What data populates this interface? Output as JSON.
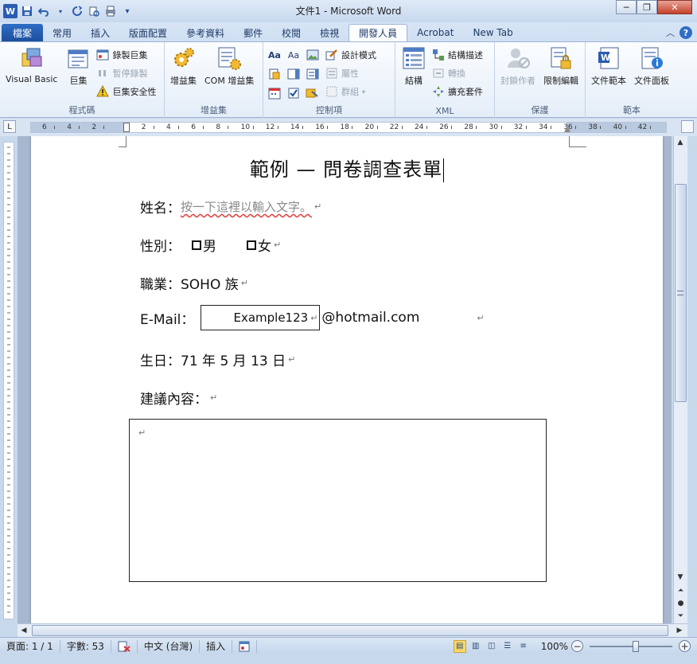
{
  "window": {
    "title": "文件1 - Microsoft Word",
    "minimize": "─",
    "restore": "❐",
    "close": "✕"
  },
  "qat": {
    "logo": "W",
    "save_icon": "floppy-disk-icon",
    "undo_icon": "undo-icon",
    "redo_icon": "redo-icon",
    "customize": "▾"
  },
  "tabs": [
    {
      "label": "檔案"
    },
    {
      "label": "常用"
    },
    {
      "label": "插入"
    },
    {
      "label": "版面配置"
    },
    {
      "label": "參考資料"
    },
    {
      "label": "郵件"
    },
    {
      "label": "校閱"
    },
    {
      "label": "檢視"
    },
    {
      "label": "開發人員"
    },
    {
      "label": "Acrobat"
    },
    {
      "label": "New Tab"
    }
  ],
  "help": "?",
  "ribbon": {
    "code": {
      "label": "程式碼",
      "visual_basic": "Visual Basic",
      "macros": "巨集",
      "record_macro": "錄製巨集",
      "pause_recording": "暫停錄製",
      "macro_security": "巨集安全性"
    },
    "addins": {
      "label": "增益集",
      "addins": "增益集",
      "com_addins": "COM 增益集"
    },
    "controls": {
      "label": "控制項",
      "design_mode": "設計模式",
      "properties": "屬性",
      "group": "群組"
    },
    "xml": {
      "label": "XML",
      "structure": "結構",
      "schema": "結構描述",
      "transform": "轉換",
      "expansion_packs": "擴充套件"
    },
    "protect": {
      "label": "保護",
      "block_authors": "封鎖作者",
      "restrict_editing": "限制編輯"
    },
    "templates": {
      "label": "範本",
      "document_template": "文件範本",
      "document_panel": "文件面板"
    }
  },
  "ruler": {
    "corner": "L",
    "ticks": [
      "6",
      "4",
      "2",
      "",
      "2",
      "4",
      "6",
      "8",
      "10",
      "12",
      "14",
      "16",
      "18",
      "20",
      "22",
      "24",
      "26",
      "28",
      "30",
      "32",
      "34",
      "36",
      "38",
      "40",
      "42"
    ]
  },
  "document": {
    "title": "範例 — 問卷調查表單",
    "name_label": "姓名：",
    "name_placeholder": "按一下這裡以輸入文字。",
    "gender_label": "性別：",
    "gender_male": "男",
    "gender_female": "女",
    "job_label": "職業：",
    "job_value": "SOHO 族",
    "email_label": "E-Mail：",
    "email_value": "Example123",
    "email_domain": "@hotmail.com",
    "birthday_label": "生日：",
    "birthday_value": "71 年 5 月 13 日",
    "suggestion_label": "建議內容：",
    "paragraph_mark": "↵"
  },
  "statusbar": {
    "page": "頁面: 1 / 1",
    "words": "字數: 53",
    "language": "中文 (台灣)",
    "insert": "插入",
    "zoom": "100%",
    "zoom_minus": "−",
    "zoom_plus": "+"
  }
}
